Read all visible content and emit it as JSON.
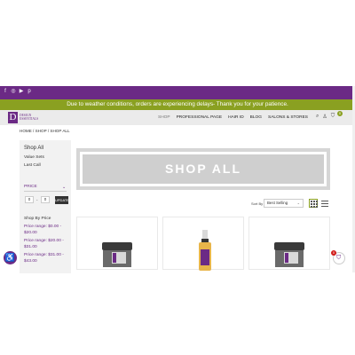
{
  "social": {
    "icons": [
      "facebook-icon",
      "instagram-icon",
      "youtube-icon",
      "pinterest-icon"
    ]
  },
  "announcement": "Due to weather conditions, orders are experiencing delays- Thank you for your patience.",
  "brand": {
    "mark": "D",
    "line1": "DESIGN",
    "line2": "ESSENTIALS"
  },
  "nav": {
    "items": [
      "SHOP",
      "PROFESSIONAL PAGE",
      "HAIR ID",
      "BLOG",
      "SALONS & STORES"
    ],
    "active": "SHOP"
  },
  "header_icons": {
    "search": "⌕",
    "account": "♙",
    "cart": "⛉",
    "cart_count": "0"
  },
  "breadcrumb": "HOME / SHOP / SHOP ALL",
  "sidebar": {
    "title": "Shop All",
    "links": [
      "Value Sets",
      "Last Call"
    ],
    "price_heading": "PRICE",
    "price_chevron": "⌄",
    "min_value": "0",
    "max_value": "0",
    "dash": "-",
    "update_label": "UPDATE",
    "shop_by_price": "Shop By Price",
    "price_links": [
      "Price range: $0.00 - $20.00",
      "Price range: $20.00 - $31.00",
      "Price range: $31.00 - $43.00"
    ]
  },
  "hero": {
    "title": "SHOP ALL"
  },
  "sort": {
    "label": "Sort By",
    "value": "Best Selling",
    "chevron": "⌄"
  },
  "colors": {
    "brand_purple": "#6b2a85",
    "accent_green": "#8aa021"
  },
  "widgets": {
    "accessibility_glyph": "♿",
    "cart_count": "0",
    "cart_glyph": "⛉"
  }
}
